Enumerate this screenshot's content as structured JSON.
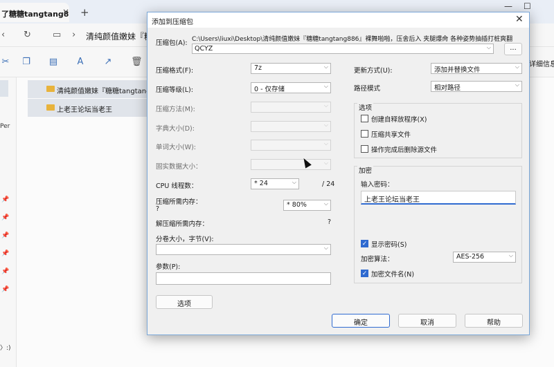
{
  "explorer": {
    "tab_title": "了糖糖tangtang8",
    "tab_close": "×",
    "new_tab": "+",
    "window_controls": [
      "—",
      "☐"
    ],
    "path": "清纯颜值嫩妹『糖",
    "detail_label": "详细信息",
    "sidebar_text": [
      "Per",
      "〉:)"
    ],
    "files": [
      "清纯颜值嫩妹『糖糖tangtang",
      "上老王论坛当老王"
    ],
    "icons": [
      "back-icon",
      "refresh-icon",
      "pc-icon",
      "cut-icon",
      "copy-icon",
      "paste-icon",
      "rename-icon",
      "share-icon",
      "delete-icon"
    ]
  },
  "dialog": {
    "title": "添加到压缩包",
    "close": "✕",
    "archive_label": "压缩包(A):",
    "archive_dir": "C:\\Users\\liuxi\\Desktop\\清纯颜值嫩妹『糖糖tangtang886』裸舞啪啪，压舍后入 夹腿爆肏 各种姿势抽插打桩爽翻",
    "archive_name": "QCYZ",
    "browse_label": "...",
    "format_label": "压缩格式(F):",
    "format_value": "7z",
    "level_label": "压缩等级(L):",
    "level_value": "0 - 仅存储",
    "method_label": "压缩方法(M):",
    "dict_label": "字典大小(D):",
    "word_label": "单词大小(W):",
    "solid_label": "固实数据大小：",
    "cpu_label": "CPU 线程数：",
    "cpu_value": "* 24",
    "cpu_total": "/ 24",
    "mem_label": "压缩所需内存：",
    "mem_q": "?",
    "mem_value": "* 80%",
    "decomp_label": "解压缩所需内存：",
    "decomp_q": "?",
    "split_label": "分卷大小，字节(V):",
    "params_label": "参数(P):",
    "options_button": "选项",
    "update_label": "更新方式(U):",
    "update_value": "添加并替换文件",
    "path_mode_label": "路径模式",
    "path_mode_value": "相对路径",
    "options_group": "选项",
    "opt_sfx": "创建自释放程序(X)",
    "opt_shared": "压缩共享文件",
    "opt_delete": "操作完成后删除源文件",
    "encryption_group": "加密",
    "password_label": "输入密码：",
    "password_value": "上老王论坛当老王",
    "show_password": "显示密码(S)",
    "enc_method_label": "加密算法：",
    "enc_method_value": "AES-256",
    "encrypt_names": "加密文件名(N)",
    "ok": "确定",
    "cancel": "取消",
    "help": "帮助"
  },
  "colors": {
    "accent": "#2f6ad0",
    "folder": "#e8b33c",
    "selection": "#e0e4ea"
  }
}
